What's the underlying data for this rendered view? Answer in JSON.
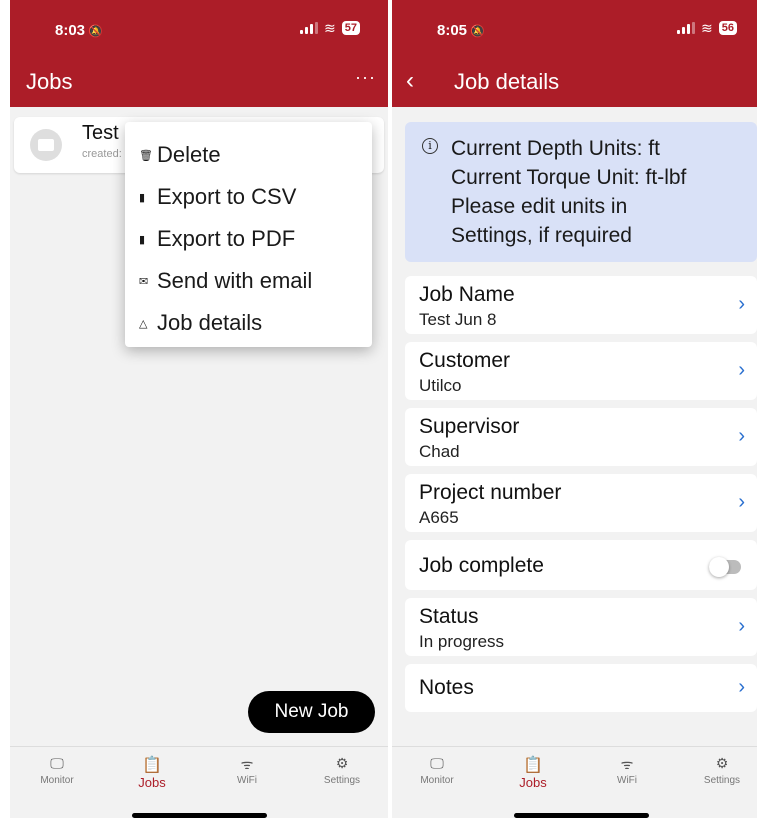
{
  "left": {
    "status": {
      "time": "8:03",
      "battery": "57"
    },
    "title": "Jobs",
    "more_label": "···",
    "job": {
      "name": "Test",
      "created": "created:"
    },
    "menu": [
      {
        "icon": "trash-icon",
        "glyph": "🗑",
        "label": "Delete"
      },
      {
        "icon": "file-icon",
        "glyph": "▮",
        "label": "Export to CSV"
      },
      {
        "icon": "file-icon",
        "glyph": "▮",
        "label": "Export to PDF"
      },
      {
        "icon": "mail-icon",
        "glyph": "✉",
        "label": "Send with email"
      },
      {
        "icon": "warning-icon",
        "glyph": "△",
        "label": "Job details"
      }
    ],
    "new_job_label": "New Job"
  },
  "right": {
    "status": {
      "time": "8:05",
      "battery": "56"
    },
    "title": "Job details",
    "info": {
      "line1": "Current Depth Units: ft",
      "line2": "Current Torque Unit: ft-lbf",
      "line3": "Please edit units in",
      "line4": "Settings, if required"
    },
    "fields": [
      {
        "label": "Job Name",
        "value": "Test Jun 8"
      },
      {
        "label": "Customer",
        "value": "Utilco"
      },
      {
        "label": "Supervisor",
        "value": "Chad"
      },
      {
        "label": "Project number",
        "value": "A665"
      }
    ],
    "job_complete": {
      "label": "Job complete",
      "checked": false
    },
    "status_field": {
      "label": "Status",
      "value": "In progress"
    },
    "notes": {
      "label": "Notes"
    }
  },
  "tabs": [
    {
      "icon": "monitor-icon",
      "label": "Monitor"
    },
    {
      "icon": "clipboard-icon",
      "label": "Jobs",
      "active": true
    },
    {
      "icon": "wifi-icon",
      "label": "WiFi"
    },
    {
      "icon": "gear-icon",
      "label": "Settings"
    }
  ],
  "colors": {
    "brand": "#ac1d28",
    "link": "#2a6fcf",
    "info_bg": "#d9e1f7"
  }
}
